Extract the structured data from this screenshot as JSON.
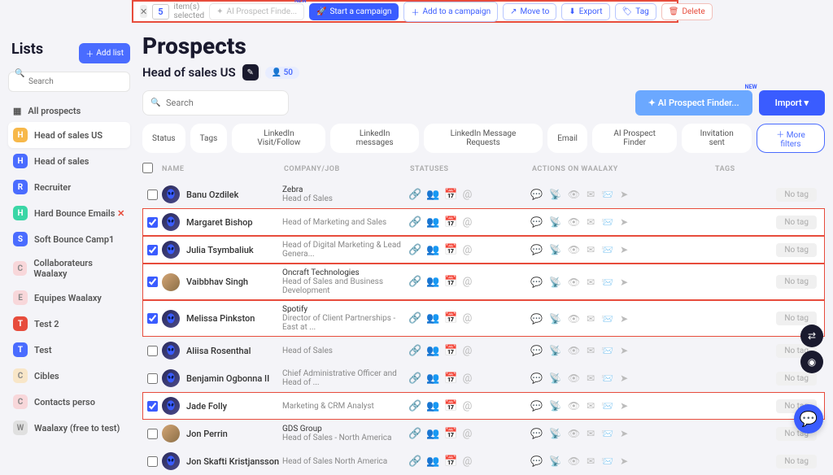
{
  "topbar": {
    "selected_count": "5",
    "selected_text": "item(s) selected",
    "ai_finder": "AI Prospect Finde...",
    "start_campaign": "Start a campaign",
    "add_campaign": "Add to a campaign",
    "move_to": "Move to",
    "export": "Export",
    "tag": "Tag",
    "delete": "Delete"
  },
  "sidebar": {
    "title": "Lists",
    "add_list": "Add list",
    "search_placeholder": "Search",
    "all_prospects": "All prospects",
    "items": [
      {
        "letter": "H",
        "color": "#f7b84a",
        "label": "Head of sales US",
        "active": true
      },
      {
        "letter": "H",
        "color": "#4a6cff",
        "label": "Head of sales"
      },
      {
        "letter": "R",
        "color": "#4a6cff",
        "label": "Recruiter"
      },
      {
        "letter": "H",
        "color": "#3ad6a6",
        "label": "Hard Bounce Emails",
        "suffix": "✕"
      },
      {
        "letter": "S",
        "color": "#4a6cff",
        "label": "Soft Bounce Camp1"
      },
      {
        "letter": "C",
        "color": "#f8d7da",
        "label": "Collaborateurs Waalaxy",
        "text_dark": true
      },
      {
        "letter": "E",
        "color": "#f8d7da",
        "label": "Equipes Waalaxy",
        "text_dark": true
      },
      {
        "letter": "T",
        "color": "#e74c3c",
        "label": "Test 2"
      },
      {
        "letter": "T",
        "color": "#4a6cff",
        "label": "Test"
      },
      {
        "letter": "C",
        "color": "#f8e6c8",
        "label": "Cibles",
        "text_dark": true
      },
      {
        "letter": "C",
        "color": "#f8d7da",
        "label": "Contacts perso",
        "text_dark": true
      },
      {
        "letter": "W",
        "color": "#e0e0e0",
        "label": "Waalaxy (free to test)",
        "text_dark": true
      }
    ]
  },
  "main": {
    "heading": "Prospects",
    "list_title": "Head of sales US",
    "list_count": "50",
    "search_placeholder": "Search",
    "ai_finder": "AI Prospect Finder...",
    "import": "Import",
    "filters": [
      "Status",
      "Tags",
      "LinkedIn Visit/Follow",
      "LinkedIn messages",
      "LinkedIn Message Requests",
      "Email",
      "AI Prospect Finder",
      "Invitation sent"
    ],
    "more_filters": "More filters",
    "headers": {
      "name": "NAME",
      "company": "COMPANY/JOB",
      "statuses": "STATUSES",
      "actions": "ACTIONS ON WAALAXY",
      "tags": "TAGS"
    },
    "no_tag": "No tag",
    "rows": [
      {
        "checked": false,
        "boxed": false,
        "name": "Banu Ozdilek",
        "company": "Zebra",
        "job": "Head of Sales"
      },
      {
        "checked": true,
        "boxed": true,
        "name": "Margaret Bishop",
        "company": "",
        "job": "Head of Marketing and Sales"
      },
      {
        "checked": true,
        "boxed": true,
        "name": "Julia Tsymbaliuk",
        "company": "",
        "job": "Head of Digital Marketing & Lead Genera..."
      },
      {
        "checked": true,
        "boxed": true,
        "name": "Vaibbhav Singh",
        "company": "Oncraft Technologies",
        "job": "Head of Sales and Business Development",
        "photo": true
      },
      {
        "checked": true,
        "boxed": true,
        "name": "Melissa Pinkston",
        "company": "Spotify",
        "job": "Director of Client Partnerships - East at ..."
      },
      {
        "checked": false,
        "boxed": false,
        "name": "Aliisa Rosenthal",
        "company": "",
        "job": "Head of Sales"
      },
      {
        "checked": false,
        "boxed": false,
        "name": "Benjamin Ogbonna II",
        "company": "",
        "job": "Chief Administrative Officer and Head of ..."
      },
      {
        "checked": true,
        "boxed": true,
        "name": "Jade Folly",
        "company": "",
        "job": "Marketing & CRM Analyst"
      },
      {
        "checked": false,
        "boxed": false,
        "name": "Jon Perrin",
        "company": "GDS Group",
        "job": "Head of Sales - North America",
        "photo": true
      },
      {
        "checked": false,
        "boxed": false,
        "name": "Jon Skafti Kristjansson",
        "company": "",
        "job": "Head of Sales North America"
      }
    ]
  }
}
